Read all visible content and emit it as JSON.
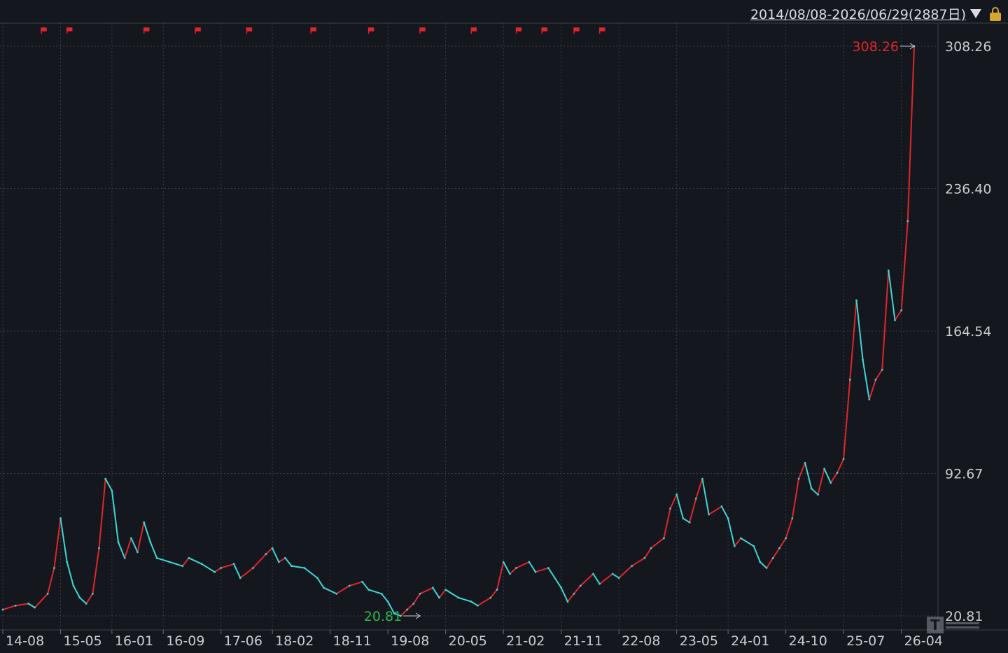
{
  "range": {
    "label": "2014/08/08-2026/06/29(2887日)"
  },
  "icons": {
    "dropdown": "triangle-down-icon",
    "lock": "lock-icon",
    "watermark": "brand-logo-icon"
  },
  "colors": {
    "background": "#14171d",
    "up": "#e0262b",
    "down": "#3fd6d6",
    "grid": "#3a3f48",
    "axis_text": "#c9ccd1",
    "max_label": "#e0262b",
    "min_label": "#2cb84a",
    "event_flag": "#e0262b"
  },
  "chart_data": {
    "type": "line",
    "title": "",
    "xlabel": "",
    "ylabel": "",
    "date_range": "2014/08/08-2026/06/29",
    "ylim": [
      20.81,
      308.26
    ],
    "y_ticks": [
      "308.26",
      "236.40",
      "164.54",
      "92.67",
      "20.81"
    ],
    "y_tick_values": [
      308.26,
      236.4,
      164.54,
      92.67,
      20.81
    ],
    "x_ticks": [
      "14-08",
      "15-05",
      "16-01",
      "16-09",
      "17-06",
      "18-02",
      "18-11",
      "19-08",
      "20-05",
      "21-02",
      "21-11",
      "22-08",
      "23-05",
      "24-01",
      "24-10",
      "25-07",
      "26-04"
    ],
    "max_label": "308.26",
    "min_label": "20.81",
    "max_point": {
      "x": "2026-06",
      "y": 308.26
    },
    "min_point": {
      "x": "2019-08",
      "y": 20.81
    },
    "event_flags_x": [
      "2015-02",
      "2015-06",
      "2016-06",
      "2017-02",
      "2017-10",
      "2018-08",
      "2019-05",
      "2020-01",
      "2020-09",
      "2021-04",
      "2021-08",
      "2022-01",
      "2022-05"
    ],
    "series": [
      {
        "values": [
          [
            "2014-08",
            24
          ],
          [
            "2014-10",
            26
          ],
          [
            "2014-12",
            27
          ],
          [
            "2015-01",
            25
          ],
          [
            "2015-03",
            32
          ],
          [
            "2015-04",
            45
          ],
          [
            "2015-05",
            70
          ],
          [
            "2015-06",
            48
          ],
          [
            "2015-07",
            36
          ],
          [
            "2015-08",
            30
          ],
          [
            "2015-09",
            27
          ],
          [
            "2015-10",
            32
          ],
          [
            "2015-11",
            55
          ],
          [
            "2015-12",
            90
          ],
          [
            "2016-01",
            84
          ],
          [
            "2016-02",
            58
          ],
          [
            "2016-03",
            50
          ],
          [
            "2016-04",
            60
          ],
          [
            "2016-05",
            53
          ],
          [
            "2016-06",
            68
          ],
          [
            "2016-07",
            58
          ],
          [
            "2016-08",
            50
          ],
          [
            "2016-10",
            48
          ],
          [
            "2016-12",
            46
          ],
          [
            "2017-01",
            50
          ],
          [
            "2017-03",
            47
          ],
          [
            "2017-05",
            43
          ],
          [
            "2017-06",
            45
          ],
          [
            "2017-08",
            47
          ],
          [
            "2017-09",
            40
          ],
          [
            "2017-11",
            45
          ],
          [
            "2018-01",
            52
          ],
          [
            "2018-02",
            55
          ],
          [
            "2018-03",
            48
          ],
          [
            "2018-04",
            50
          ],
          [
            "2018-05",
            46
          ],
          [
            "2018-07",
            45
          ],
          [
            "2018-09",
            40
          ],
          [
            "2018-10",
            35
          ],
          [
            "2018-12",
            32
          ],
          [
            "2019-02",
            36
          ],
          [
            "2019-04",
            38
          ],
          [
            "2019-05",
            34
          ],
          [
            "2019-07",
            32
          ],
          [
            "2019-08",
            28
          ],
          [
            "2019-09",
            22
          ],
          [
            "2019-10",
            20.81
          ],
          [
            "2019-11",
            24
          ],
          [
            "2019-12",
            27
          ],
          [
            "2020-01",
            32
          ],
          [
            "2020-03",
            35
          ],
          [
            "2020-04",
            30
          ],
          [
            "2020-05",
            34
          ],
          [
            "2020-07",
            30
          ],
          [
            "2020-09",
            28
          ],
          [
            "2020-10",
            26
          ],
          [
            "2020-12",
            30
          ],
          [
            "2021-01",
            34
          ],
          [
            "2021-02",
            48
          ],
          [
            "2021-03",
            42
          ],
          [
            "2021-04",
            45
          ],
          [
            "2021-06",
            48
          ],
          [
            "2021-07",
            43
          ],
          [
            "2021-09",
            45
          ],
          [
            "2021-11",
            35
          ],
          [
            "2021-12",
            28
          ],
          [
            "2022-01",
            32
          ],
          [
            "2022-02",
            36
          ],
          [
            "2022-04",
            42
          ],
          [
            "2022-05",
            37
          ],
          [
            "2022-07",
            42
          ],
          [
            "2022-08",
            40
          ],
          [
            "2022-10",
            46
          ],
          [
            "2022-12",
            50
          ],
          [
            "2023-01",
            55
          ],
          [
            "2023-03",
            60
          ],
          [
            "2023-04",
            75
          ],
          [
            "2023-05",
            82
          ],
          [
            "2023-06",
            70
          ],
          [
            "2023-07",
            68
          ],
          [
            "2023-08",
            80
          ],
          [
            "2023-09",
            90
          ],
          [
            "2023-10",
            72
          ],
          [
            "2023-12",
            76
          ],
          [
            "2024-01",
            70
          ],
          [
            "2024-02",
            56
          ],
          [
            "2024-03",
            60
          ],
          [
            "2024-05",
            56
          ],
          [
            "2024-06",
            48
          ],
          [
            "2024-07",
            45
          ],
          [
            "2024-08",
            50
          ],
          [
            "2024-09",
            55
          ],
          [
            "2024-10",
            60
          ],
          [
            "2024-11",
            70
          ],
          [
            "2024-12",
            90
          ],
          [
            "2025-01",
            98
          ],
          [
            "2025-02",
            85
          ],
          [
            "2025-03",
            82
          ],
          [
            "2025-04",
            95
          ],
          [
            "2025-05",
            88
          ],
          [
            "2025-06",
            93
          ],
          [
            "2025-07",
            100
          ],
          [
            "2025-08",
            140
          ],
          [
            "2025-09",
            180
          ],
          [
            "2025-10",
            150
          ],
          [
            "2025-11",
            130
          ],
          [
            "2025-12",
            140
          ],
          [
            "2026-01",
            145
          ],
          [
            "2026-02",
            195
          ],
          [
            "2026-03",
            170
          ],
          [
            "2026-04",
            175
          ],
          [
            "2026-05",
            220
          ],
          [
            "2026-06",
            308.26
          ]
        ]
      }
    ]
  }
}
